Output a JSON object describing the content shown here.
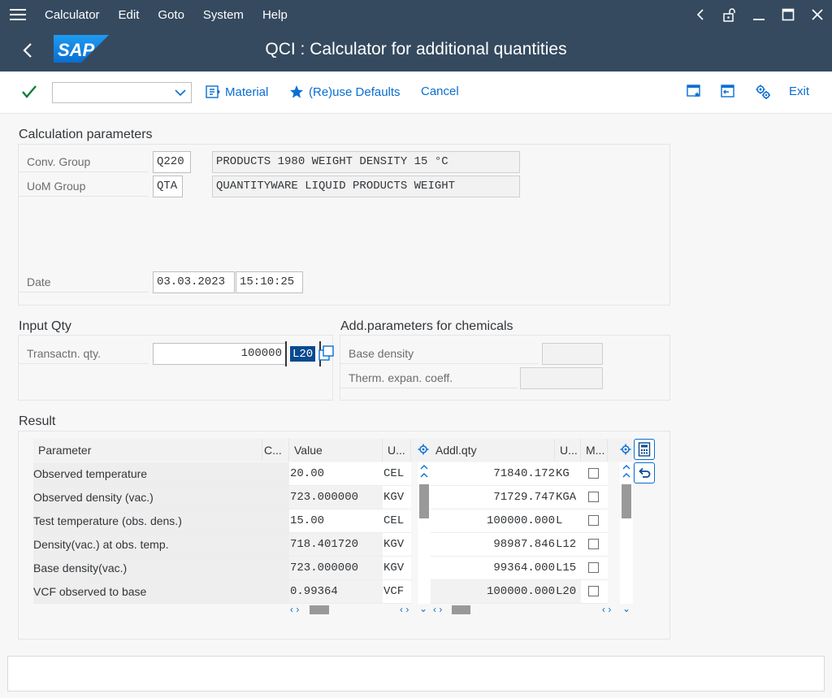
{
  "menu": {
    "items": [
      "Calculator",
      "Edit",
      "Goto",
      "System",
      "Help"
    ]
  },
  "title": {
    "logo_text": "SAP",
    "text": "QCI : Calculator for additional quantities"
  },
  "toolbar": {
    "command_value": "",
    "material_label": "Material",
    "reuse_label": "(Re)use Defaults",
    "cancel_label": "Cancel",
    "exit_label": "Exit"
  },
  "calc_params": {
    "title": "Calculation parameters",
    "conv_group_label": "Conv. Group",
    "conv_group_value": "Q220",
    "conv_group_desc": "PRODUCTS 1980 WEIGHT DENSITY 15 °C",
    "uom_group_label": "UoM Group",
    "uom_group_value": "QTA",
    "uom_group_desc": "QUANTITYWARE LIQUID PRODUCTS WEIGHT",
    "date_label": "Date",
    "date_value": "03.03.2023",
    "time_value": "15:10:25"
  },
  "input_qty": {
    "title": "Input Qty",
    "label": "Transactn. qty.",
    "value": "100000",
    "unit": "L20"
  },
  "add_params": {
    "title": "Add.parameters for chemicals",
    "base_density_label": "Base density",
    "base_density_value": "",
    "therm_label": "Therm. expan. coeff.",
    "therm_value": ""
  },
  "result": {
    "title": "Result",
    "left_headers": {
      "parameter": "Parameter",
      "c": "C...",
      "value": "Value",
      "unit": "U..."
    },
    "right_headers": {
      "qty": "Addl.qty",
      "unit": "U...",
      "m": "M..."
    },
    "rows": [
      {
        "parameter": "Observed temperature",
        "value": "20.00",
        "unit": "CEL"
      },
      {
        "parameter": "Observed density (vac.)",
        "value": "723.000000",
        "unit": "KGV"
      },
      {
        "parameter": "Test temperature (obs. dens.)",
        "value": "15.00",
        "unit": "CEL"
      },
      {
        "parameter": "Density(vac.) at obs. temp.",
        "value": "718.401720",
        "unit": "KGV"
      },
      {
        "parameter": "Base density(vac.)",
        "value": "723.000000",
        "unit": "KGV"
      },
      {
        "parameter": "VCF observed to base",
        "value": "0.99364",
        "unit": "VCF"
      }
    ],
    "qty_rows": [
      {
        "qty": "71840.172",
        "unit": "KG"
      },
      {
        "qty": "71729.747",
        "unit": "KGA"
      },
      {
        "qty": "100000.000",
        "unit": "L"
      },
      {
        "qty": "98987.846",
        "unit": "L12"
      },
      {
        "qty": "99364.000",
        "unit": "L15"
      },
      {
        "qty": "100000.000",
        "unit": "L20"
      }
    ]
  },
  "colors": {
    "shell": "#354a5f",
    "accent": "#0a6ed1",
    "check": "#107e3e"
  }
}
